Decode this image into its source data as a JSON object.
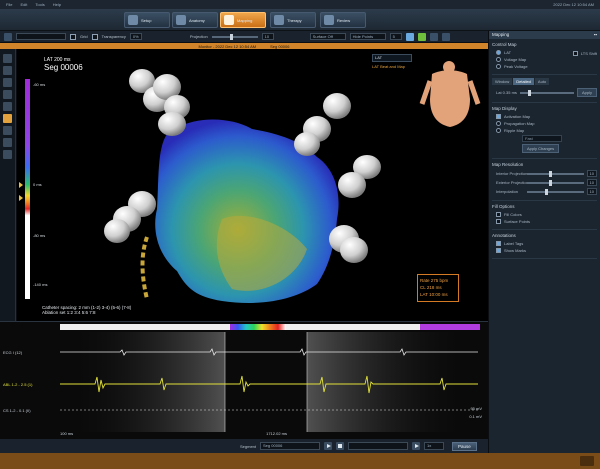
{
  "titlebar": {
    "left": [
      "File",
      "Edit",
      "Tools",
      "Help"
    ],
    "right": "2022 Dec 12 10:54 AM"
  },
  "modules": [
    {
      "label": "Setup",
      "icon": "setup-icon",
      "active": false
    },
    {
      "label": "Anatomy",
      "icon": "anatomy-icon",
      "active": false
    },
    {
      "label": "Mapping",
      "icon": "mapping-icon",
      "active": true
    },
    {
      "label": "Therapy",
      "icon": "therapy-icon",
      "active": false
    },
    {
      "label": "Review",
      "icon": "review-icon",
      "active": false
    }
  ],
  "toolbar": {
    "dropdown": "",
    "check1_label": "Grid",
    "check2_label": "Transparency",
    "check2_value": "0%",
    "slider_label": "Projection",
    "slider_value": "10",
    "field_a": "Surface Off",
    "field_b": "Hide Points",
    "field_c": "5"
  },
  "mapbar": {
    "left": "Monitor - 2022 Dec 12 10:54 AM",
    "right": "Seg 00006"
  },
  "viewport": {
    "seg_small": "LAT 200 ms",
    "seg_name": "Seg 00006",
    "ticks": [
      "-60 ms",
      "0 ms",
      "-80 ms",
      "-140 ms"
    ],
    "map_select": "LAT",
    "lat_label": "LAT Beat and Map",
    "info": [
      "Rate 275 bpm",
      "CL 218 ms",
      "LAT 10:00 ms"
    ],
    "electrode_line1": "Catheter spacing: 2 mm (1-2) 3-4) (5-6) (7-8)",
    "electrode_line2": "Ablation set   1:2   3:4   5:6   7:8"
  },
  "ecg": {
    "rows": [
      {
        "label": "ECG I (12)",
        "scale": ""
      },
      {
        "label": "ABL 1-2 - 2.5 (1)",
        "scale": ""
      },
      {
        "label": "CS 1-2 - 0.1 (II)",
        "scale": ""
      }
    ],
    "scale_right": [
      "95 mV",
      "0.1 mV"
    ],
    "time_left": "100 ms",
    "time_mid": "1712.02 ms"
  },
  "player": {
    "label": "Segment",
    "segment": "Seg 00006",
    "speed": "1x",
    "pause_btn": "Pause"
  },
  "rpanel": {
    "title": "Mapping",
    "controls_title": "Control Map",
    "controls": [
      {
        "label": "LAT",
        "on": true,
        "kind": "radio"
      },
      {
        "label": "Voltage Map",
        "on": false,
        "kind": "radio"
      },
      {
        "label": "Peak Voltage",
        "on": false,
        "kind": "radio"
      },
      {
        "label": "LTS Shift",
        "on": false,
        "kind": "check"
      }
    ],
    "window_title": "Window",
    "window_tabs": [
      "Simple",
      "Detailed",
      "Auto"
    ],
    "window_active": 1,
    "window_slider_label": "Lat 0.35 ms",
    "window_btn": "Apply",
    "map_display_title": "Map Display",
    "map_display": [
      {
        "label": "Activation Map",
        "on": true
      },
      {
        "label": "Propagation Map",
        "on": false
      },
      {
        "label": "Ripple Map",
        "on": false
      }
    ],
    "map_display_dd": "Fast",
    "map_display_btn": "Apply Changes",
    "map_resolution_title": "Map Resolution",
    "resolution": [
      {
        "label": "Interior Projection",
        "value": "10"
      },
      {
        "label": "Exterior Projection",
        "value": "10"
      },
      {
        "label": "Interpolation",
        "value": "10"
      }
    ],
    "fill_title": "Fill Options",
    "fill": [
      {
        "label": "Fill Colors",
        "on": false
      },
      {
        "label": "Surface Points",
        "on": false
      }
    ],
    "annot_title": "Annotations",
    "annot": [
      {
        "label": "Label Tags",
        "on": true
      },
      {
        "label": "Show Marks",
        "on": true
      }
    ]
  },
  "colors": {
    "accent": "#d1842a",
    "active_module": "#f0a64a",
    "ecg_ablation": "#e2e23a",
    "ecg_cs": "#e6e6e6"
  }
}
